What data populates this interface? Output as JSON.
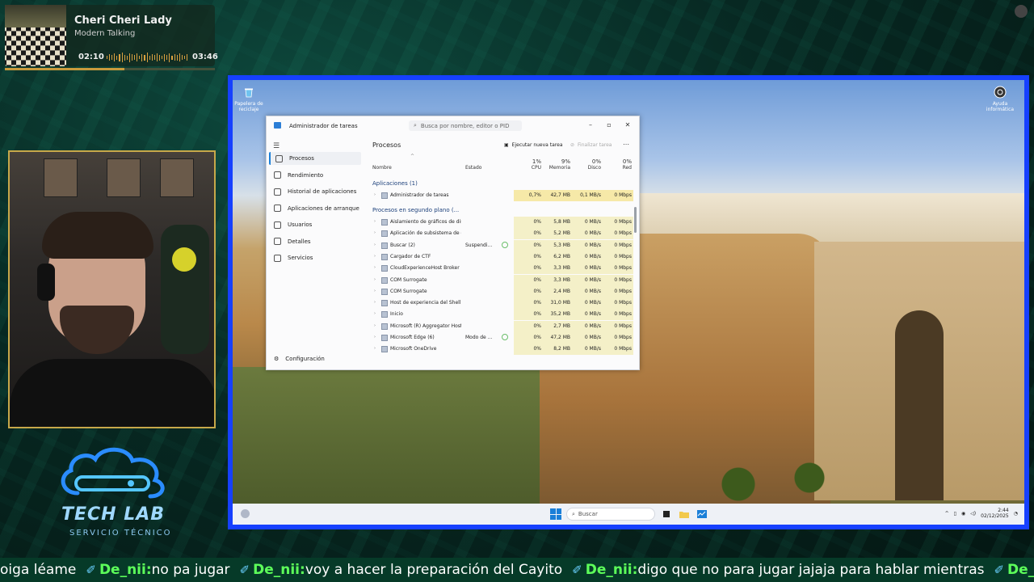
{
  "music": {
    "title": "Cheri Cheri Lady",
    "artist": "Modern Talking",
    "elapsed": "02:10",
    "duration": "03:46",
    "progress_fraction": 0.57
  },
  "logo": {
    "name": "TECH LAB",
    "subtitle": "SERVICIO TÉCNICO"
  },
  "desktop": {
    "icons": [
      {
        "label": "Papelera de reciclaje",
        "icon": "recycle-bin-icon"
      },
      {
        "label": "Ayuda informática",
        "icon": "help-icon"
      }
    ]
  },
  "taskbar": {
    "search_placeholder": "Buscar",
    "time": "2:44",
    "date": "02/12/2025"
  },
  "task_manager": {
    "title": "Administrador de tareas",
    "search_placeholder": "Busca por nombre, editor o PID",
    "nav": [
      {
        "label": "Procesos",
        "icon": "processes-icon",
        "active": true
      },
      {
        "label": "Rendimiento",
        "icon": "performance-icon"
      },
      {
        "label": "Historial de aplicaciones",
        "icon": "history-icon"
      },
      {
        "label": "Aplicaciones de arranque",
        "icon": "startup-icon"
      },
      {
        "label": "Usuarios",
        "icon": "users-icon"
      },
      {
        "label": "Detalles",
        "icon": "details-icon"
      },
      {
        "label": "Servicios",
        "icon": "services-icon"
      }
    ],
    "settings_label": "Configuración",
    "heading": "Procesos",
    "run_task": "Ejecutar nueva tarea",
    "end_task": "Finalizar tarea",
    "columns": {
      "name": "Nombre",
      "status": "Estado",
      "cpu_pct": "1%",
      "cpu": "CPU",
      "mem_pct": "9%",
      "mem": "Memoria",
      "disk_pct": "0%",
      "disk": "Disco",
      "net_pct": "0%",
      "net": "Red"
    },
    "apps_group": "Aplicaciones (1)",
    "bg_group": "Procesos en segundo plano (...",
    "apps": [
      {
        "name": "Administrador de tareas",
        "status": "",
        "cpu": "0,7%",
        "mem": "42,7 MB",
        "disk": "0,1 MB/s",
        "net": "0 Mbps"
      }
    ],
    "background": [
      {
        "name": "Aislamiento de gráficos de dis...",
        "status": "",
        "cpu": "0%",
        "mem": "5,8 MB",
        "disk": "0 MB/s",
        "net": "0 Mbps"
      },
      {
        "name": "Aplicación de subsistema de c...",
        "status": "",
        "cpu": "0%",
        "mem": "5,2 MB",
        "disk": "0 MB/s",
        "net": "0 Mbps"
      },
      {
        "name": "Buscar (2)",
        "status": "Suspendi...",
        "cpu": "0%",
        "mem": "5,3 MB",
        "disk": "0 MB/s",
        "net": "0 Mbps"
      },
      {
        "name": "Cargador de CTF",
        "status": "",
        "cpu": "0%",
        "mem": "6,2 MB",
        "disk": "0 MB/s",
        "net": "0 Mbps"
      },
      {
        "name": "CloudExperienceHost Broker",
        "status": "",
        "cpu": "0%",
        "mem": "3,3 MB",
        "disk": "0 MB/s",
        "net": "0 Mbps"
      },
      {
        "name": "COM Surrogate",
        "status": "",
        "cpu": "0%",
        "mem": "3,3 MB",
        "disk": "0 MB/s",
        "net": "0 Mbps"
      },
      {
        "name": "COM Surrogate",
        "status": "",
        "cpu": "0%",
        "mem": "2,4 MB",
        "disk": "0 MB/s",
        "net": "0 Mbps"
      },
      {
        "name": "Host de experiencia del Shell d...",
        "status": "",
        "cpu": "0%",
        "mem": "31,0 MB",
        "disk": "0 MB/s",
        "net": "0 Mbps"
      },
      {
        "name": "Inicio",
        "status": "",
        "cpu": "0%",
        "mem": "35,2 MB",
        "disk": "0 MB/s",
        "net": "0 Mbps"
      },
      {
        "name": "Microsoft (R) Aggregator Host",
        "status": "",
        "cpu": "0%",
        "mem": "2,7 MB",
        "disk": "0 MB/s",
        "net": "0 Mbps"
      },
      {
        "name": "Microsoft Edge (6)",
        "status": "Modo de ...",
        "cpu": "0%",
        "mem": "47,2 MB",
        "disk": "0 MB/s",
        "net": "0 Mbps"
      },
      {
        "name": "Microsoft OneDrive",
        "status": "",
        "cpu": "0%",
        "mem": "8,2 MB",
        "disk": "0 MB/s",
        "net": "0 Mbps"
      }
    ]
  },
  "chat": [
    {
      "user": "",
      "msg": "oiga léame"
    },
    {
      "user": "De_nii:",
      "msg": "no pa jugar"
    },
    {
      "user": "De_nii:",
      "msg": "voy a hacer la preparación del Cayito"
    },
    {
      "user": "De_nii:",
      "msg": "digo que no para jugar jajaja para hablar mientras"
    },
    {
      "user": "De_nii:",
      "msg": ""
    }
  ],
  "colors": {
    "accent_blue": "#1640ff",
    "chat_user": "#5dff5a",
    "logo_blue": "#9fd8ff"
  }
}
